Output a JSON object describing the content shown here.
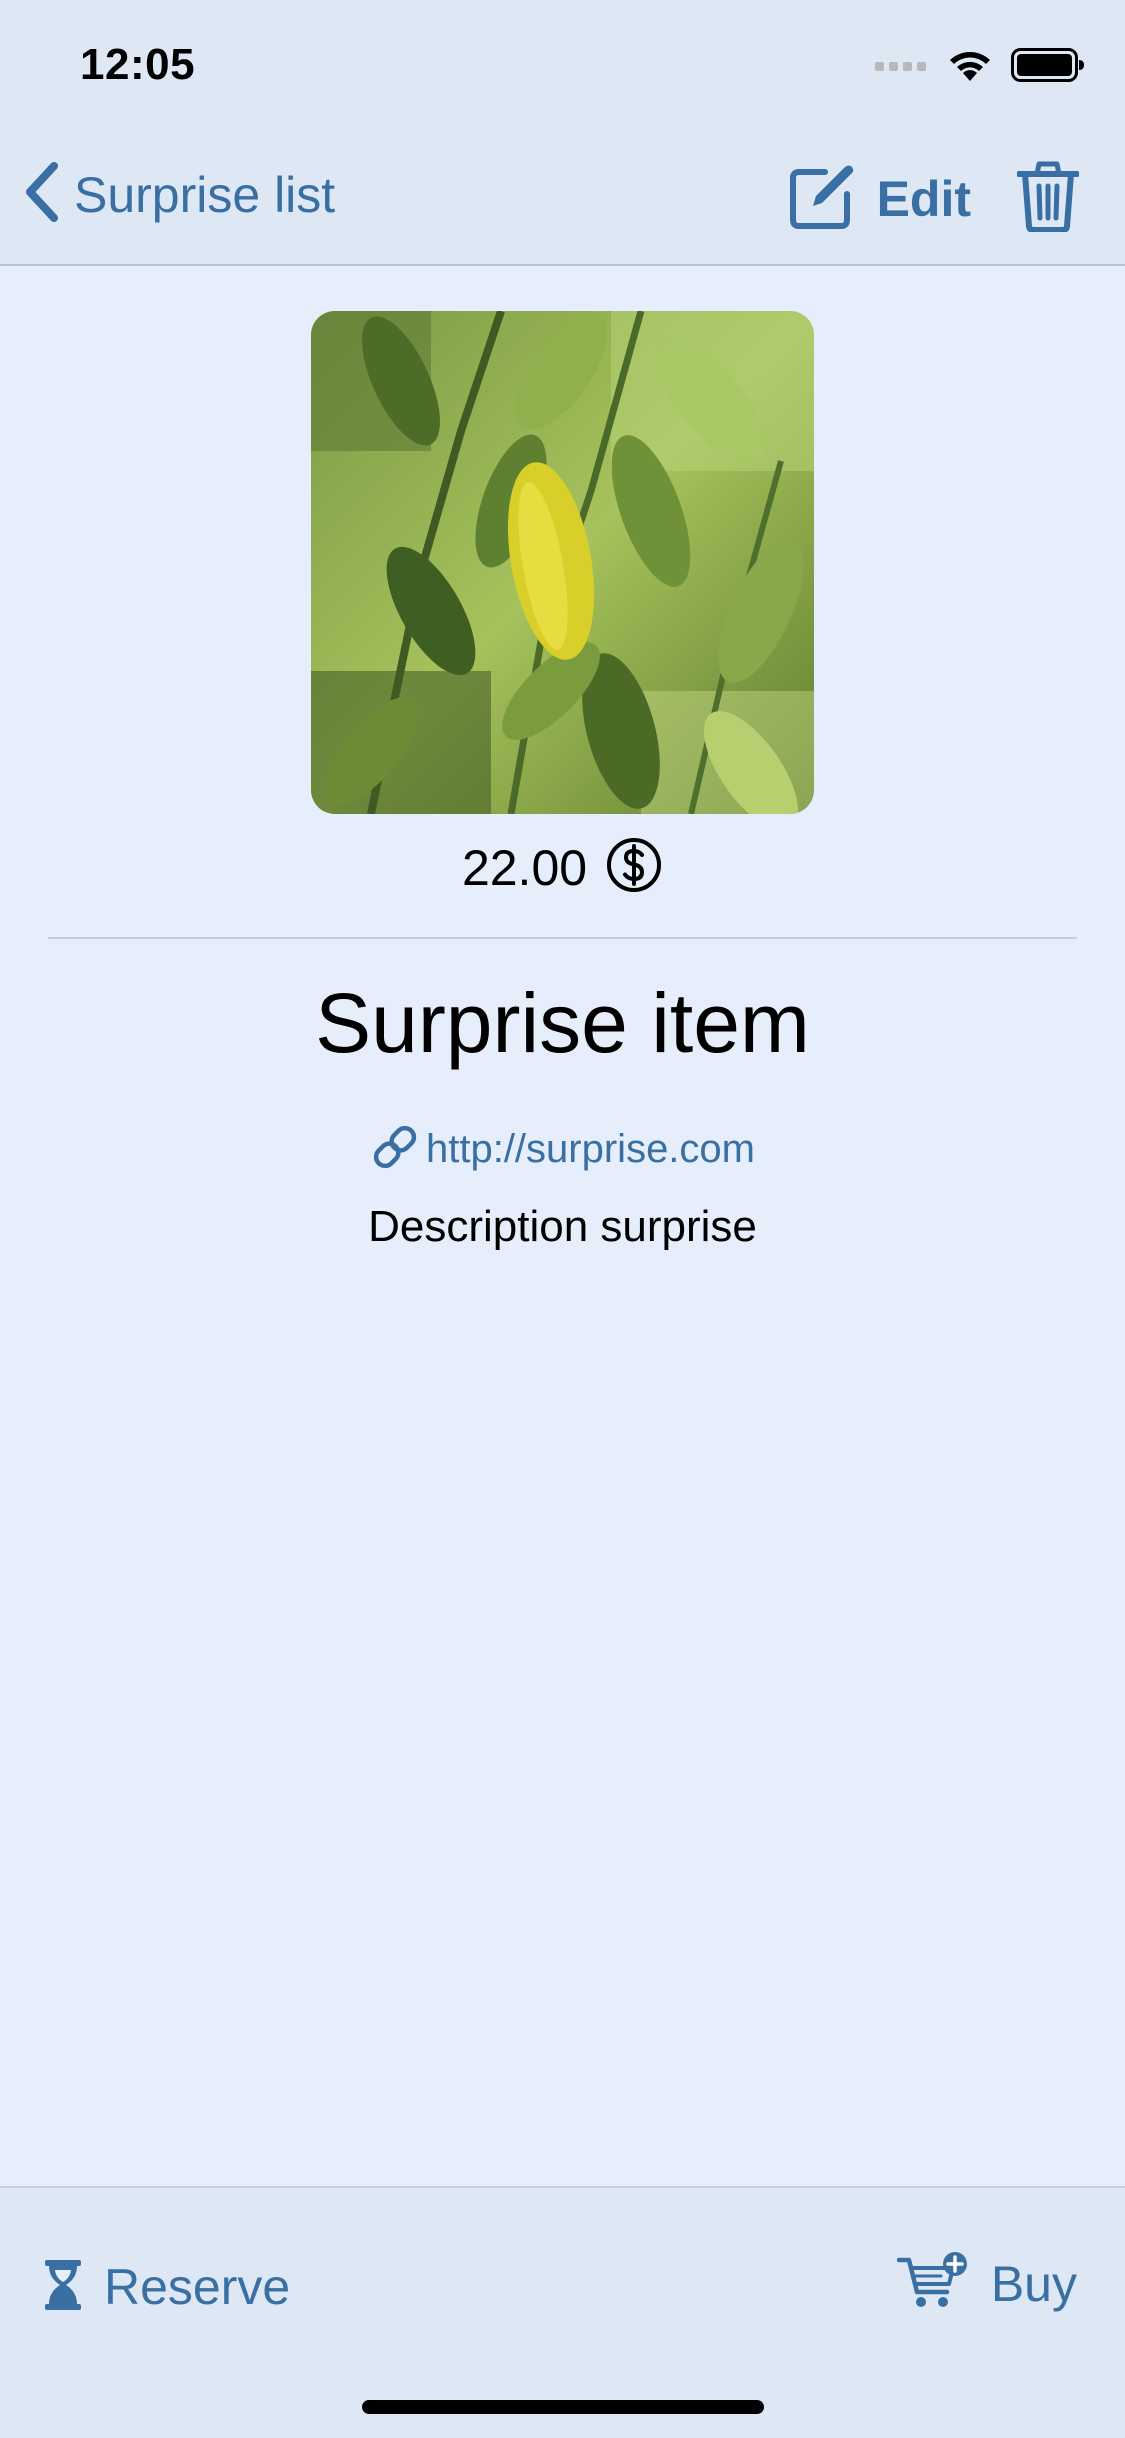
{
  "status_bar": {
    "time": "12:05"
  },
  "nav": {
    "back_label": "Surprise list",
    "edit_label": "Edit"
  },
  "item": {
    "price": "22.00",
    "currency_icon": "dollar-circle-icon",
    "title": "Surprise item",
    "link": "http://surprise.com",
    "description": "Description surprise"
  },
  "toolbar": {
    "reserve_label": "Reserve",
    "buy_label": "Buy"
  },
  "colors": {
    "accent": "#3a6fa3",
    "background": "#e5eefa",
    "bar_background": "#dee8f5"
  }
}
